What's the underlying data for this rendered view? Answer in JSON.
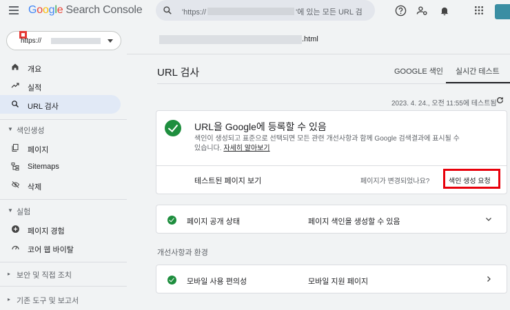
{
  "header": {
    "logo_google": [
      "G",
      "o",
      "o",
      "g",
      "l",
      "e"
    ],
    "logo_product": "Search Console",
    "search_prefix": "'https://",
    "search_suffix": "'에 있는 모든 URL 검"
  },
  "sidebar": {
    "property_prefix": "https://",
    "items": [
      {
        "label": "개요",
        "icon": "home-icon",
        "active": false
      },
      {
        "label": "실적",
        "icon": "trend-icon",
        "active": false
      },
      {
        "label": "URL 검사",
        "icon": "search-icon",
        "active": true
      }
    ],
    "section_indexing": "색인생성",
    "indexing_items": [
      {
        "label": "페이지",
        "icon": "pages-icon"
      },
      {
        "label": "Sitemaps",
        "icon": "sitemap-icon"
      },
      {
        "label": "삭제",
        "icon": "removal-icon"
      }
    ],
    "section_experience": "실험",
    "experience_items": [
      {
        "label": "페이지 경험",
        "icon": "page-experience-icon"
      },
      {
        "label": "코어 웹 바이탈",
        "icon": "speed-icon"
      }
    ],
    "section_security": "보안 및 직접 조치",
    "section_legacy": "기존 도구 및 보고서"
  },
  "main": {
    "url_suffix": ".html",
    "page_title": "URL 검사",
    "tabs": [
      "GOOGLE 색인",
      "실시간 테스트"
    ],
    "tested_text": "2023. 4. 24., 오전 11:55에 테스트됨",
    "result_card": {
      "title": "URL을 Google에 등록할 수 있음",
      "desc": "색인이 생성되고 표준으로 선택되면 모든 관련 개선사항과 함께 Google 검색결과에 표시될 수 있습니다.",
      "learn_more": "자세히 알아보기",
      "view_tested": "테스트된 페이지 보기",
      "changed_question": "페이지가 변경되었나요?",
      "request_indexing": "색인 생성 요청"
    },
    "availability_row": {
      "label": "페이지 공개 상태",
      "value": "페이지 색인을 생성할 수 있음"
    },
    "improvements_heading": "개선사항과 환경",
    "mobile_row": {
      "label": "모바일 사용 편의성",
      "value": "모바일 지원 페이지"
    }
  },
  "colors": {
    "accent": "#1a73e8",
    "success": "#1e8e3e",
    "highlight": "#e8000b",
    "active_nav": "#e1e9f6"
  }
}
